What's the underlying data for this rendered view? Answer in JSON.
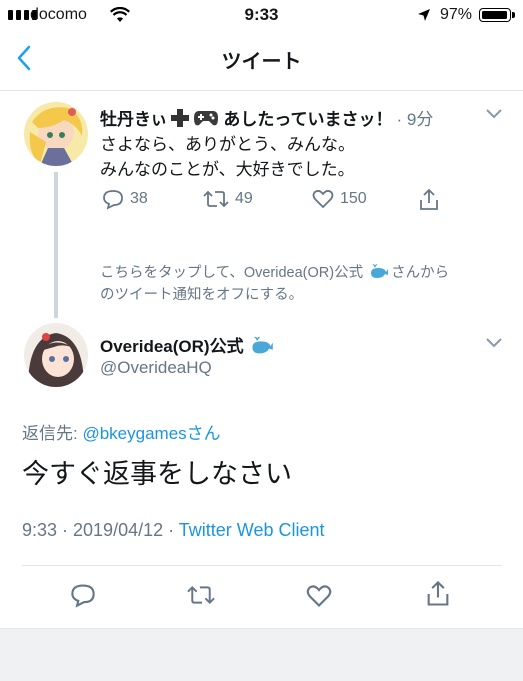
{
  "status_bar": {
    "carrier": "docomo",
    "time": "9:33",
    "battery": "97%"
  },
  "nav": {
    "title": "ツイート"
  },
  "parent_tweet": {
    "author_name": "牡丹きぃ",
    "author_name_rest": "あしたっていまさッ！",
    "time_ago": "· 9分",
    "lines": [
      "さよなら、ありがとう、みんな。",
      "みんなのことが、大好きでした。"
    ],
    "replies": "38",
    "retweets": "49",
    "likes": "150"
  },
  "notice": {
    "line1_before": "こちらをタップして、Overidea(OR)公式",
    "line1_after": "さんから",
    "line2": "のツイート通知をオフにする。"
  },
  "main_tweet": {
    "author_name": "Overidea(OR)公式",
    "handle": "@OverideaHQ",
    "reply_prefix": "返信先: ",
    "reply_to": "@bkeygamesさん",
    "text": "今すぐ返事をしなさい",
    "timestamp": "9:33 · 2019/04/12 · ",
    "client": "Twitter Web Client"
  },
  "colors": {
    "accent": "#1b95e0",
    "muted": "#657786",
    "divider": "#e1e8ed"
  }
}
